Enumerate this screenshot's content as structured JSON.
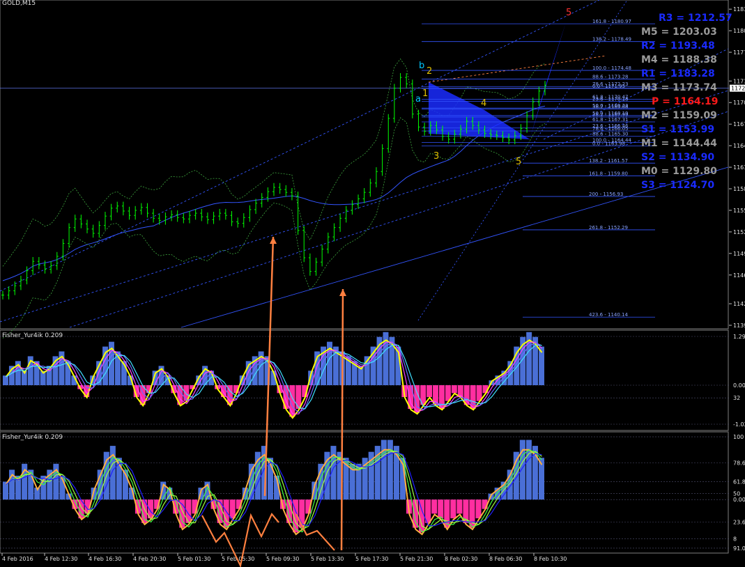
{
  "symbol_title": "GOLD,M15",
  "panel2_title": "Fisher_Yur4ik 0.209",
  "panel3_title": "Fisher_Yur4ik 0.209",
  "colors": {
    "background": "#000000",
    "candle": "#00ff00",
    "grid": "#3a3a5a",
    "channel": "#3355ff",
    "fib": "#3355ff",
    "pattern_fill": "#1a2bff",
    "pivot_gray": "#9a9a9a",
    "pivot_blue": "#1a2bff",
    "pivot_red": "#ff1a1a",
    "hist_pos": "#4a6fd6",
    "hist_neg": "#ff2ea0",
    "arrow": "#ff8040"
  },
  "chart_data": {
    "type": "line",
    "title": "GOLD,M15",
    "price_axis": {
      "ticks": [
        "1183",
        "1180",
        "1177",
        "1173",
        "1170",
        "1167",
        "1164",
        "1161",
        "1158",
        "1155",
        "1152",
        "1149",
        "1146",
        "1142",
        "1139"
      ],
      "current_price_label": "1172"
    },
    "time_axis": {
      "ticks": [
        "4 Feb 2016",
        "4 Feb 12:30",
        "4 Feb 16:30",
        "4 Feb 20:30",
        "5 Feb 01:30",
        "5 Feb 05:30",
        "5 Feb 09:30",
        "5 Feb 13:30",
        "5 Feb 17:30",
        "5 Feb 21:30",
        "8 Feb 02:30",
        "8 Feb 06:30",
        "8 Feb 10:30"
      ]
    },
    "close_series": [
      1143.2,
      1143.8,
      1144.5,
      1145.3,
      1146.6,
      1147.9,
      1147.4,
      1146.8,
      1147.3,
      1148.6,
      1150.4,
      1152.6,
      1153.8,
      1153.1,
      1152.4,
      1151.8,
      1152.9,
      1154.2,
      1155.3,
      1155.6,
      1154.9,
      1154.3,
      1155.0,
      1155.4,
      1154.6,
      1153.9,
      1153.6,
      1154.1,
      1154.4,
      1154.0,
      1153.8,
      1154.3,
      1154.6,
      1154.1,
      1153.7,
      1154.2,
      1154.6,
      1154.3,
      1153.4,
      1153.2,
      1154.0,
      1155.1,
      1156.0,
      1156.8,
      1157.6,
      1158.2,
      1157.9,
      1157.5,
      1157.0,
      1152.2,
      1148.4,
      1146.5,
      1147.8,
      1149.6,
      1151.3,
      1152.6,
      1153.9,
      1155.0,
      1155.8,
      1156.6,
      1157.5,
      1158.8,
      1160.4,
      1163.6,
      1167.8,
      1172.0,
      1173.5,
      1172.6,
      1168.4,
      1166.6,
      1166.0,
      1166.8,
      1166.2,
      1165.3,
      1164.9,
      1165.6,
      1166.3,
      1167.4,
      1166.8,
      1166.2,
      1165.7,
      1165.5,
      1165.4,
      1165.1,
      1164.8,
      1165.4,
      1166.4,
      1168.2,
      1170.1,
      1171.6,
      1172.4
    ],
    "fib_levels": [
      {
        "label": "161.8 - 1180.97"
      },
      {
        "label": "138.2 - 1178.49"
      },
      {
        "label": "100.0 - 1174.48"
      },
      {
        "label": "88.6 - 1173.28"
      },
      {
        "label": "78.6 - 1172.23"
      },
      {
        "label": "0.0 - 1171.95"
      },
      {
        "label": "61.8 - 1170.47"
      },
      {
        "label": "23.6 - 1170.18"
      },
      {
        "label": "50.0 - 1169.23"
      },
      {
        "label": "38.2 - 1169.08"
      },
      {
        "label": "38.2 - 1167.99"
      },
      {
        "label": "50.0 - 1168.19"
      },
      {
        "label": "61.8 - 1167.31"
      },
      {
        "label": "23.6 - 1166.46"
      },
      {
        "label": "78.6 - 1166.05"
      },
      {
        "label": "88.6 - 1165.30"
      },
      {
        "label": "100.0 - 1164.44"
      },
      {
        "label": "0.0 - 1163.98"
      },
      {
        "label": "138.2 - 1161.57"
      },
      {
        "label": "161.8 - 1159.80"
      },
      {
        "label": "200 - 1156.93"
      },
      {
        "label": "261.8 - 1152.29"
      },
      {
        "label": "423.6 - 1140.14"
      }
    ],
    "pivots": [
      {
        "label": "R3 = 1212.57",
        "color": "blue"
      },
      {
        "label": "M5 = 1203.03",
        "color": "gray"
      },
      {
        "label": "R2 = 1193.48",
        "color": "blue"
      },
      {
        "label": "M4 = 1188.38",
        "color": "gray"
      },
      {
        "label": "R1 = 1183.28",
        "color": "blue"
      },
      {
        "label": "M3 = 1173.74",
        "color": "gray"
      },
      {
        "label": "P = 1164.19",
        "color": "red"
      },
      {
        "label": "M2 = 1159.09",
        "color": "gray"
      },
      {
        "label": "S1 = 1153.99",
        "color": "blue"
      },
      {
        "label": "M1 = 1144.44",
        "color": "gray"
      },
      {
        "label": "S2 = 1134.90",
        "color": "blue"
      },
      {
        "label": "M0 = 1129.80",
        "color": "gray"
      },
      {
        "label": "S3 = 1124.70",
        "color": "blue"
      }
    ],
    "wave_labels": [
      "5",
      "b",
      "2",
      "1",
      "a",
      "4",
      "3",
      "5"
    ],
    "indicator1": {
      "name": "Fisher_Yur4ik 0.209",
      "ticks": [
        "1.29",
        "0.00",
        "32",
        "-1.02"
      ],
      "histogram": [
        0.2,
        0.4,
        0.5,
        0.3,
        0.6,
        0.5,
        0.3,
        0.4,
        0.6,
        0.7,
        0.5,
        0.2,
        -0.1,
        -0.3,
        0.2,
        0.5,
        0.8,
        0.9,
        0.7,
        0.5,
        0.2,
        -0.3,
        -0.5,
        -0.2,
        0.3,
        0.4,
        0.2,
        -0.2,
        -0.5,
        -0.4,
        -0.1,
        0.2,
        0.4,
        0.3,
        -0.1,
        -0.3,
        -0.5,
        -0.2,
        0.2,
        0.5,
        0.6,
        0.7,
        0.6,
        0.3,
        -0.2,
        -0.6,
        -0.8,
        -0.6,
        -0.3,
        0.3,
        0.7,
        0.8,
        0.9,
        0.8,
        0.7,
        0.6,
        0.5,
        0.4,
        0.6,
        0.8,
        1.0,
        1.1,
        1.0,
        0.8,
        -0.3,
        -0.6,
        -0.7,
        -0.5,
        -0.3,
        -0.5,
        -0.6,
        -0.4,
        -0.2,
        -0.3,
        -0.5,
        -0.6,
        -0.4,
        -0.2,
        0.1,
        0.2,
        0.3,
        0.5,
        0.8,
        1.0,
        1.1,
        1.0,
        0.8
      ]
    },
    "indicator2": {
      "name": "Fisher_Yur4ik 0.209",
      "ticks": [
        "100",
        "78.6",
        "61.8",
        "50",
        "0.00",
        "23.6",
        "8",
        "91.02"
      ],
      "histogram": [
        0.3,
        0.5,
        0.4,
        0.6,
        0.5,
        0.2,
        0.4,
        0.5,
        0.6,
        0.4,
        0.1,
        -0.2,
        -0.4,
        -0.3,
        0.2,
        0.5,
        0.8,
        0.9,
        0.7,
        0.5,
        0.2,
        -0.3,
        -0.5,
        -0.4,
        -0.2,
        0.3,
        0.2,
        -0.3,
        -0.6,
        -0.5,
        -0.3,
        0.2,
        0.3,
        -0.2,
        -0.5,
        -0.6,
        -0.4,
        -0.2,
        0.2,
        0.6,
        0.8,
        0.9,
        0.7,
        0.4,
        -0.2,
        -0.5,
        -0.7,
        -0.6,
        -0.3,
        0.3,
        0.6,
        0.8,
        0.9,
        0.8,
        0.7,
        0.6,
        0.6,
        0.7,
        0.8,
        0.9,
        1.0,
        1.0,
        0.9,
        0.7,
        -0.3,
        -0.6,
        -0.7,
        -0.5,
        -0.3,
        -0.4,
        -0.6,
        -0.4,
        -0.3,
        -0.5,
        -0.6,
        -0.4,
        -0.2,
        0.1,
        0.2,
        0.3,
        0.5,
        0.8,
        1.0,
        1.0,
        0.9,
        0.7
      ]
    }
  }
}
